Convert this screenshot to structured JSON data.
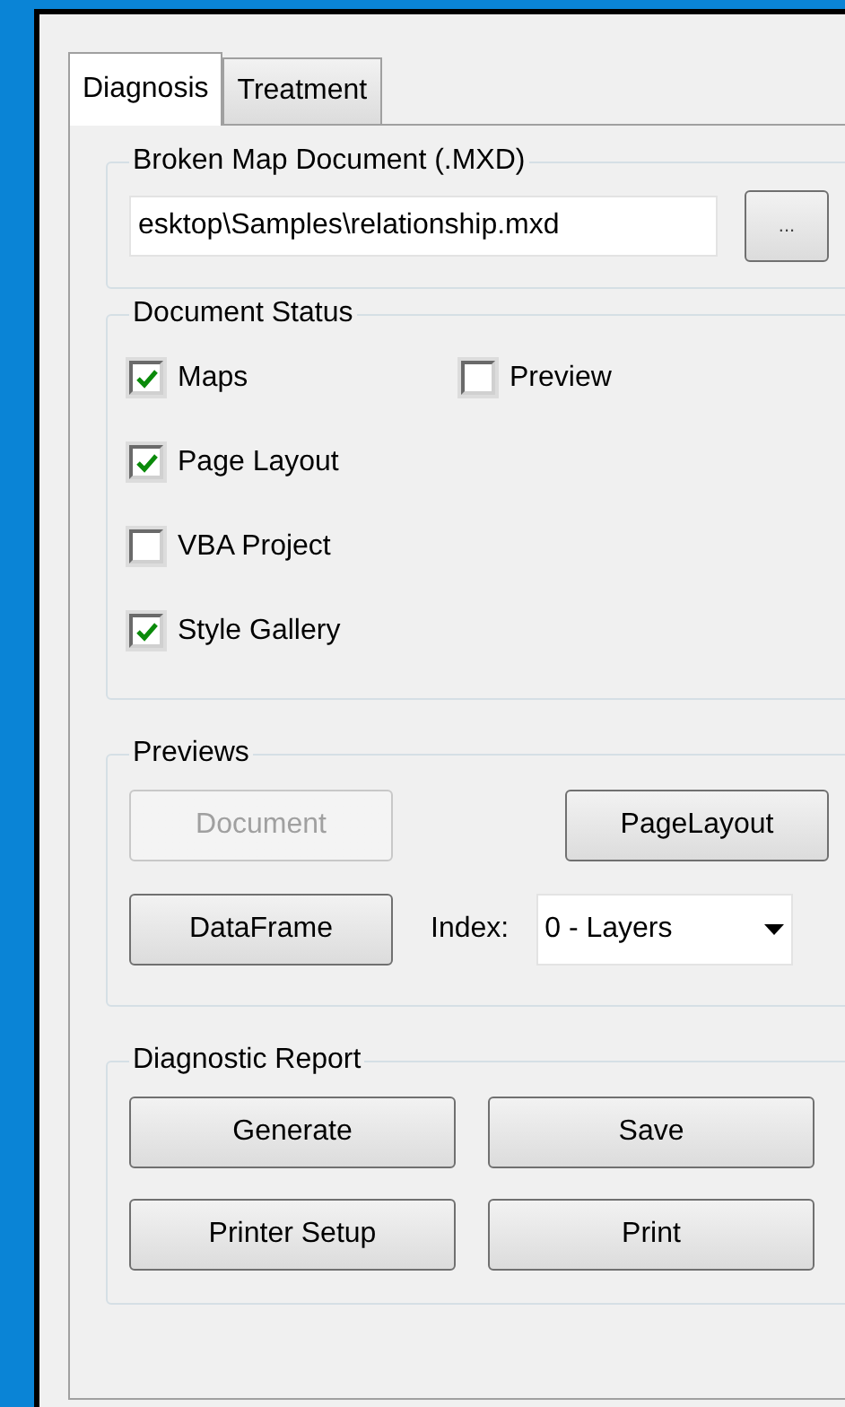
{
  "tabs": [
    {
      "label": "Diagnosis",
      "selected": true
    },
    {
      "label": "Treatment",
      "selected": false
    }
  ],
  "map_document": {
    "title": "Broken Map Document (.MXD)",
    "path": "esktop\\Samples\\relationship.mxd",
    "browse_button": "..."
  },
  "document_status": {
    "title": "Document Status",
    "columns": [
      [
        {
          "label": "Maps",
          "checked": true
        },
        {
          "label": "Page Layout",
          "checked": true
        },
        {
          "label": "VBA Project",
          "checked": false
        },
        {
          "label": "Style Gallery",
          "checked": true
        }
      ],
      [
        {
          "label": "Preview",
          "checked": false
        }
      ]
    ]
  },
  "previews": {
    "title": "Previews",
    "buttons": [
      {
        "label": "Document",
        "disabled": true
      },
      {
        "label": "PageLayout",
        "disabled": false
      },
      {
        "label": "DataFrame",
        "disabled": false
      }
    ],
    "index_label": "Index:",
    "index_value": "0 - Layers"
  },
  "report": {
    "title": "Diagnostic Report",
    "buttons": [
      "Generate",
      "Save",
      "Printer Setup",
      "Print"
    ]
  }
}
